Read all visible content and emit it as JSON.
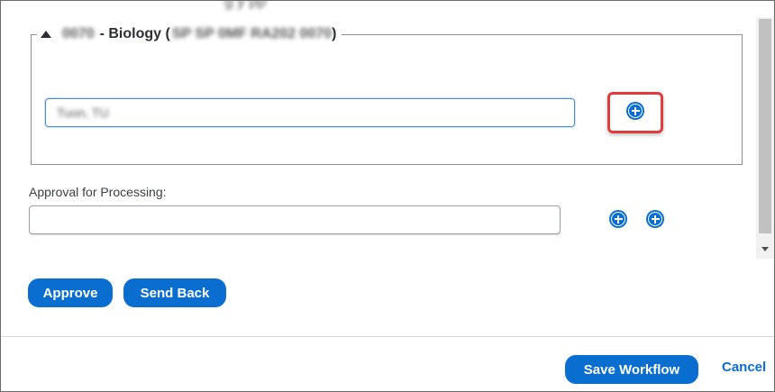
{
  "dialog": {
    "caption_partial": "g  y  pp",
    "group": {
      "legend_code": "0070",
      "legend_name": "- Biology (",
      "legend_code_detail": "SP SP 0MF RA202 0070",
      "legend_close": ")",
      "approver_value": "Tuon, TU"
    },
    "processing": {
      "label": "Approval for Processing:",
      "value": ""
    },
    "buttons": {
      "approve": "Approve",
      "send_back": "Send Back",
      "save_workflow": "Save Workflow",
      "cancel": "Cancel"
    }
  },
  "colors": {
    "accent": "#0a6ed1",
    "highlight": "#e23b3b",
    "input_focus_border": "#4a8fd6"
  },
  "icons": {
    "add": "circle-plus-icon",
    "collapse": "caret-up-icon"
  }
}
